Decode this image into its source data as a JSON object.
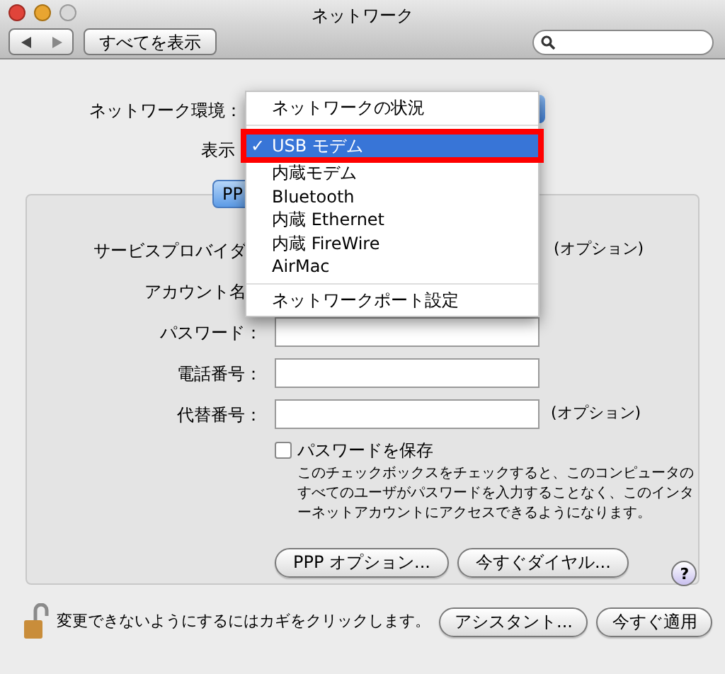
{
  "window": {
    "title": "ネットワーク"
  },
  "toolbar": {
    "show_all": "すべてを表示"
  },
  "location": {
    "label": "ネットワーク環境："
  },
  "show": {
    "label": "表示"
  },
  "menu": {
    "check_mark": "✓",
    "sections": [
      [
        {
          "label": "ネットワークの状況",
          "selected": false,
          "checked": false
        }
      ],
      [
        {
          "label": "USB モデム",
          "selected": true,
          "checked": true
        },
        {
          "label": "内蔵モデム",
          "selected": false,
          "checked": false
        },
        {
          "label": "Bluetooth",
          "selected": false,
          "checked": false
        },
        {
          "label": "内蔵 Ethernet",
          "selected": false,
          "checked": false
        },
        {
          "label": "内蔵 FireWire",
          "selected": false,
          "checked": false
        },
        {
          "label": "AirMac",
          "selected": false,
          "checked": false
        }
      ],
      [
        {
          "label": "ネットワークポート設定",
          "selected": false,
          "checked": false
        }
      ]
    ]
  },
  "tabs": [
    {
      "label": "PP",
      "selected": true
    }
  ],
  "form_rows": [
    {
      "kind": "covered",
      "label": "サービスプロバイダ",
      "note": "(オプション)"
    },
    {
      "kind": "covered",
      "label": "アカウント名"
    },
    {
      "kind": "field",
      "label": "パスワード："
    },
    {
      "kind": "field",
      "label": "電話番号："
    },
    {
      "kind": "field",
      "label": "代替番号：",
      "note": "(オプション)"
    }
  ],
  "save_password": {
    "label": "パスワードを保存",
    "checked": false,
    "description": "このチェックボックスをチェックすると、このコンピュータのすべてのユーザがパスワードを入力することなく、このインターネットアカウントにアクセスできるようになります。"
  },
  "panel_buttons": [
    "PPP オプション...",
    "今すぐダイヤル..."
  ],
  "help": "?",
  "lock": {
    "text": "変更できないようにするにはカギをクリックします。"
  },
  "bottom_buttons": [
    "アシスタント...",
    "今すぐ適用"
  ]
}
